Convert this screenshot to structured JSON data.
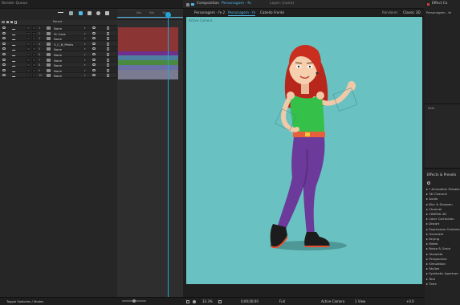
{
  "render_queue": {
    "title": "Render Queue"
  },
  "timeline": {
    "time_marks": [
      "00s",
      "05s",
      "10s"
    ],
    "layer_column_header": "Parent",
    "layers": [
      {
        "number": "1",
        "name": "None"
      },
      {
        "number": "2",
        "name": "3L.Cara"
      },
      {
        "number": "3",
        "name": "None"
      },
      {
        "number": "4",
        "name": "3_C_B_Pelvis"
      },
      {
        "number": "5",
        "name": "None"
      },
      {
        "number": "6",
        "name": "None"
      },
      {
        "number": "7",
        "name": "None"
      },
      {
        "number": "8",
        "name": "None"
      },
      {
        "number": "9",
        "name": "None"
      },
      {
        "number": "10",
        "name": "None"
      }
    ],
    "bar_colors": [
      "#8b3535",
      "#8b3535",
      "#8b3535",
      "#8b3535",
      "#8b3535",
      "#6f2f8f",
      "#4f7fa0",
      "#4a8a3e",
      "#6a6fa6",
      "#7a7a90",
      "#7a7a90"
    ],
    "toggle_label": "Toggle Switches / Modes"
  },
  "composition": {
    "panel_title": "Composition",
    "panel_title_comp": "Personagem - fe",
    "layer_label": "Layer: (none)",
    "tabs": [
      "Personagem - fe 2",
      "Personagem - fe",
      "Cabello Frente"
    ],
    "renderer_label": "Renderer:",
    "renderer_value": "Classic 3D",
    "view_label": "Active Camera",
    "zoom": "33.3%",
    "time": "0;00;00;00",
    "resolution": "Full",
    "views": "1 View",
    "exposure": "+0.0",
    "accent": "#69c2c1"
  },
  "effects": {
    "effect_controls_title": "Effect Co",
    "effect_controls_sub": "Personagem - fe",
    "grid_label": "Grid",
    "presets_title": "Effects & Presets",
    "search_icon": "magnifier-icon",
    "items": [
      "* Animation Presets",
      "3D Channel",
      "Audio",
      "Blur & Sharpen",
      "Channel",
      "CINEMA 4D",
      "Color Correction",
      "Distort",
      "Expression Controls",
      "Generate",
      "Keying",
      "Matte",
      "Noise & Grain",
      "Obsolete",
      "Perspective",
      "Simulation",
      "Stylize",
      "Synthetic Aperture",
      "Text",
      "Time"
    ]
  }
}
